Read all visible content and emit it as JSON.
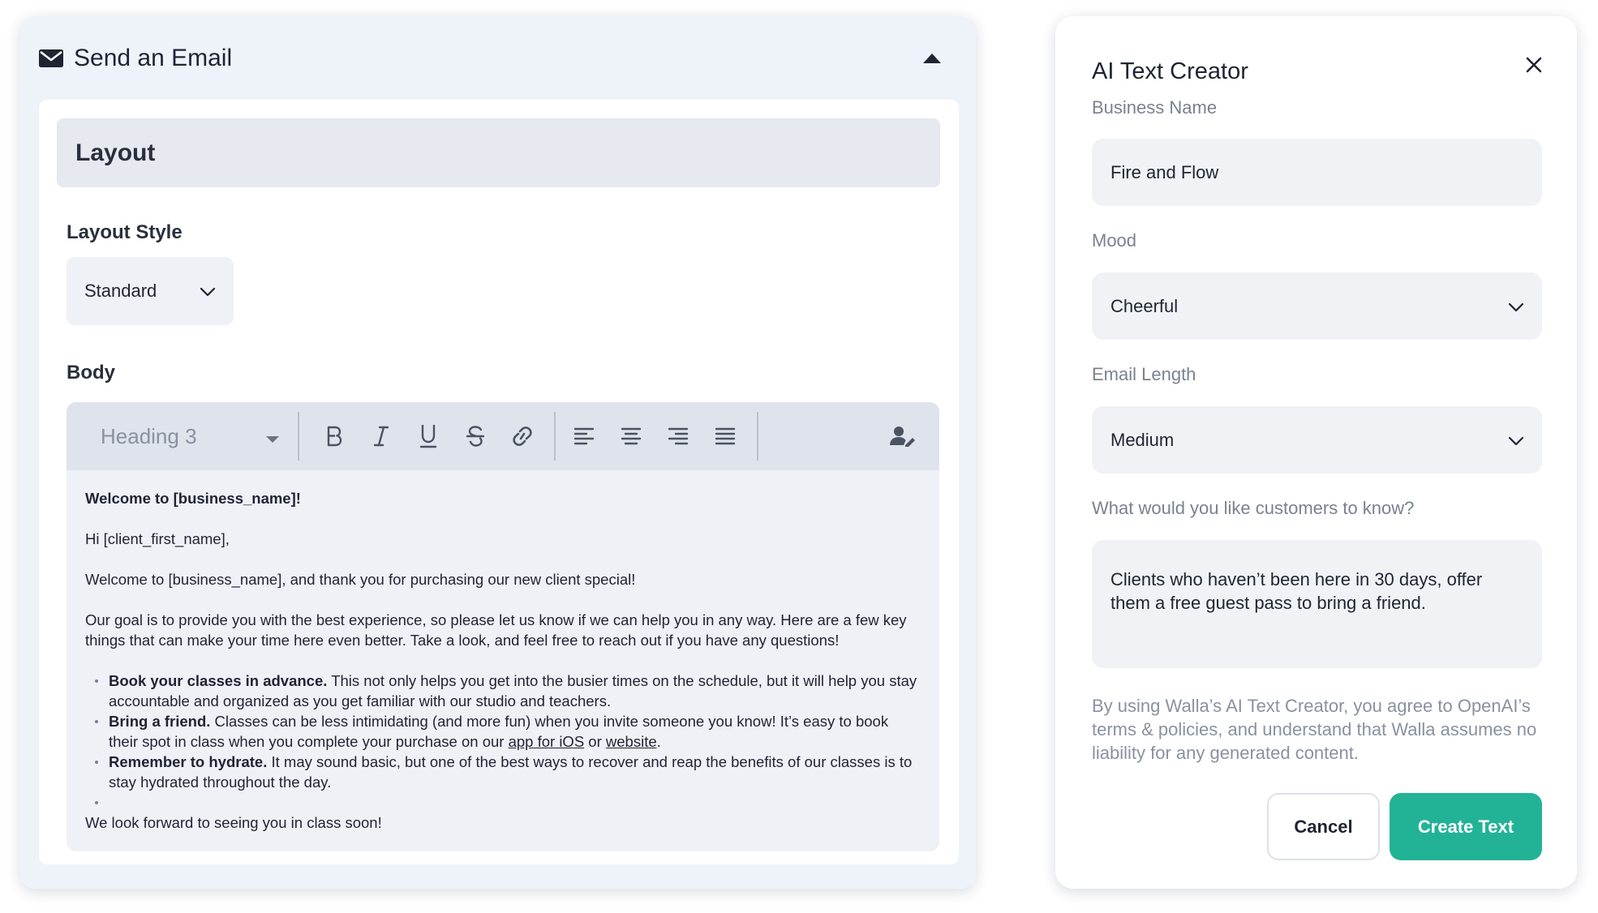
{
  "colors": {
    "accent": "#22b396",
    "panel_bg": "#eef3fa",
    "field_bg": "#f0f2f5",
    "toolbar_bg": "#dfe3eb",
    "text": "#1f2433",
    "muted": "#7a8190"
  },
  "email_panel": {
    "title": "Send an Email",
    "icons": {
      "header": "envelope-icon",
      "collapse": "caret-up-icon"
    },
    "layout_section": "Layout",
    "layout_style": {
      "label": "Layout Style",
      "value": "Standard"
    },
    "body": {
      "label": "Body",
      "toolbar": {
        "heading_select": "Heading 3",
        "buttons": [
          "bold-icon",
          "italic-icon",
          "underline-icon",
          "strikethrough-icon",
          "link-icon",
          "align-left-icon",
          "align-center-icon",
          "align-right-icon",
          "align-justify-icon",
          "personalize-user-icon"
        ]
      },
      "content": {
        "heading": "Welcome to [business_name]!",
        "greeting": "Hi [client_first_name],",
        "intro": "Welcome to [business_name], and thank you for purchasing our new client special!",
        "goal": "Our goal is to provide you with the best experience, so please let us know if we can help you in any way. Here are a few key things that can make your time here even better. Take a look, and feel free to reach out if you have any questions!",
        "tips": [
          {
            "title": "Book your classes in advance.",
            "text": "This not only helps you get into the busier times on the schedule, but it will help you stay accountable and organized as you get familiar with our studio and teachers."
          },
          {
            "title": "Bring a friend.",
            "text": "Classes can be less intimidating (and more fun) when you invite someone you know! It’s easy to book their spot in class when you complete your purchase on our",
            "link1": "app for iOS",
            "or": "or",
            "link2": "website",
            "end": "."
          },
          {
            "title": "Remember to hydrate.",
            "text": "It may sound basic, but one of the best ways to recover and reap the benefits of our classes is to stay hydrated throughout the day."
          }
        ],
        "closing": "We look forward to seeing you in class soon!"
      }
    }
  },
  "ai_panel": {
    "title": "AI Text Creator",
    "close_icon": "close-icon",
    "business_name": {
      "label": "Business Name",
      "value": "Fire and Flow"
    },
    "mood": {
      "label": "Mood",
      "value": "Cheerful"
    },
    "email_length": {
      "label": "Email Length",
      "value": "Medium"
    },
    "customers_know": {
      "label": "What would you like customers to know?",
      "value": "Clients who haven’t been here in 30 days, offer them a free guest pass to bring a friend."
    },
    "disclaimer": "By using Walla’s AI Text Creator, you agree to OpenAI’s terms & policies, and understand that Walla assumes no liability for any generated content.",
    "buttons": {
      "cancel": "Cancel",
      "create": "Create Text"
    }
  }
}
